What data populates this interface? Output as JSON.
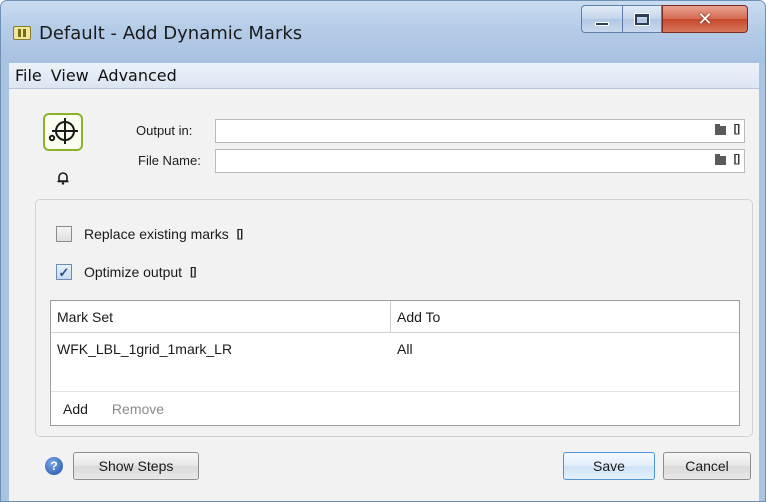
{
  "window": {
    "title": "Default - Add Dynamic Marks"
  },
  "menu": {
    "items": [
      "File",
      "View",
      "Advanced"
    ]
  },
  "fields": {
    "output_in": {
      "label": "Output in:",
      "value": ""
    },
    "file_name": {
      "label": "File Name:",
      "value": ""
    }
  },
  "options": {
    "replace_existing": {
      "label": "Replace existing marks",
      "checked": false
    },
    "optimize_output": {
      "label": "Optimize output",
      "checked": true
    }
  },
  "table": {
    "columns": [
      "Mark Set",
      "Add To"
    ],
    "rows": [
      [
        "WFK_LBL_1grid_1mark_LR",
        "All"
      ]
    ],
    "footer": {
      "add_label": "Add",
      "remove_label": "Remove"
    }
  },
  "buttons": {
    "show_steps": "Show Steps",
    "save": "Save",
    "cancel": "Cancel"
  },
  "icons": {
    "app": "app-icon",
    "tool": "crosshair-gear-icon",
    "bell": "bell-icon",
    "folder": "folder-icon",
    "bracket": "variable-bracket-icon",
    "help": "help-icon",
    "minimize": "minimize-icon",
    "maximize": "maximize-icon",
    "close": "close-icon"
  },
  "colors": {
    "title_bar": "#b5cce8",
    "accent_green": "#8ab32c",
    "save_border": "#4f93d8",
    "close_red": "#c7482c"
  }
}
